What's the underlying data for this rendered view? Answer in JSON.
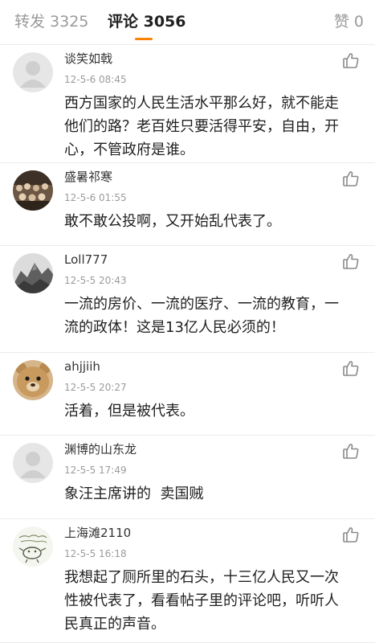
{
  "tabs": {
    "repost": "转发 3325",
    "comment": "评论 3056",
    "like": "赞 0"
  },
  "colors": {
    "accent": "#ff8200",
    "secondary_text": "#9b9b9b",
    "divider": "#ececec"
  },
  "comments": [
    {
      "username": "谈笑如戟",
      "time": "12-5-6 08:45",
      "lines": [
        "西方国家的人民生活水平那么好，就不能走",
        "他们的路？老百姓只要活得平安，自由，开",
        "心，不管政府是谁。"
      ],
      "avatar": "default-avatar-icon"
    },
    {
      "username": "盛暑祁寒",
      "time": "12-5-6 01:55",
      "lines": [
        "敢不敢公投啊，又开始乱代表了。"
      ],
      "avatar": "crowd-photo-avatar"
    },
    {
      "username": "Loll777",
      "time": "12-5-5 20:43",
      "lines": [
        "一流的房价、一流的医疗、一流的教育，一",
        "流的政体！这是13亿人民必须的！"
      ],
      "avatar": "landscape-painting-avatar"
    },
    {
      "username": "ahjjiih",
      "time": "12-5-5 20:27",
      "lines": [
        "活着，但是被代表。"
      ],
      "avatar": "teddy-bear-avatar"
    },
    {
      "username": "渊博的山东龙",
      "time": "12-5-5 17:49",
      "lines": [
        "象汪主席讲的  卖国贼"
      ],
      "avatar": "default-avatar-icon"
    },
    {
      "username": "上海滩2110",
      "time": "12-5-5 16:18",
      "lines": [
        "我想起了厕所里的石头，十三亿人民又一次",
        "性被代表了，看看帖子里的评论吧，听听人",
        "民真正的声音。"
      ],
      "avatar": "doodle-drawing-avatar"
    }
  ]
}
